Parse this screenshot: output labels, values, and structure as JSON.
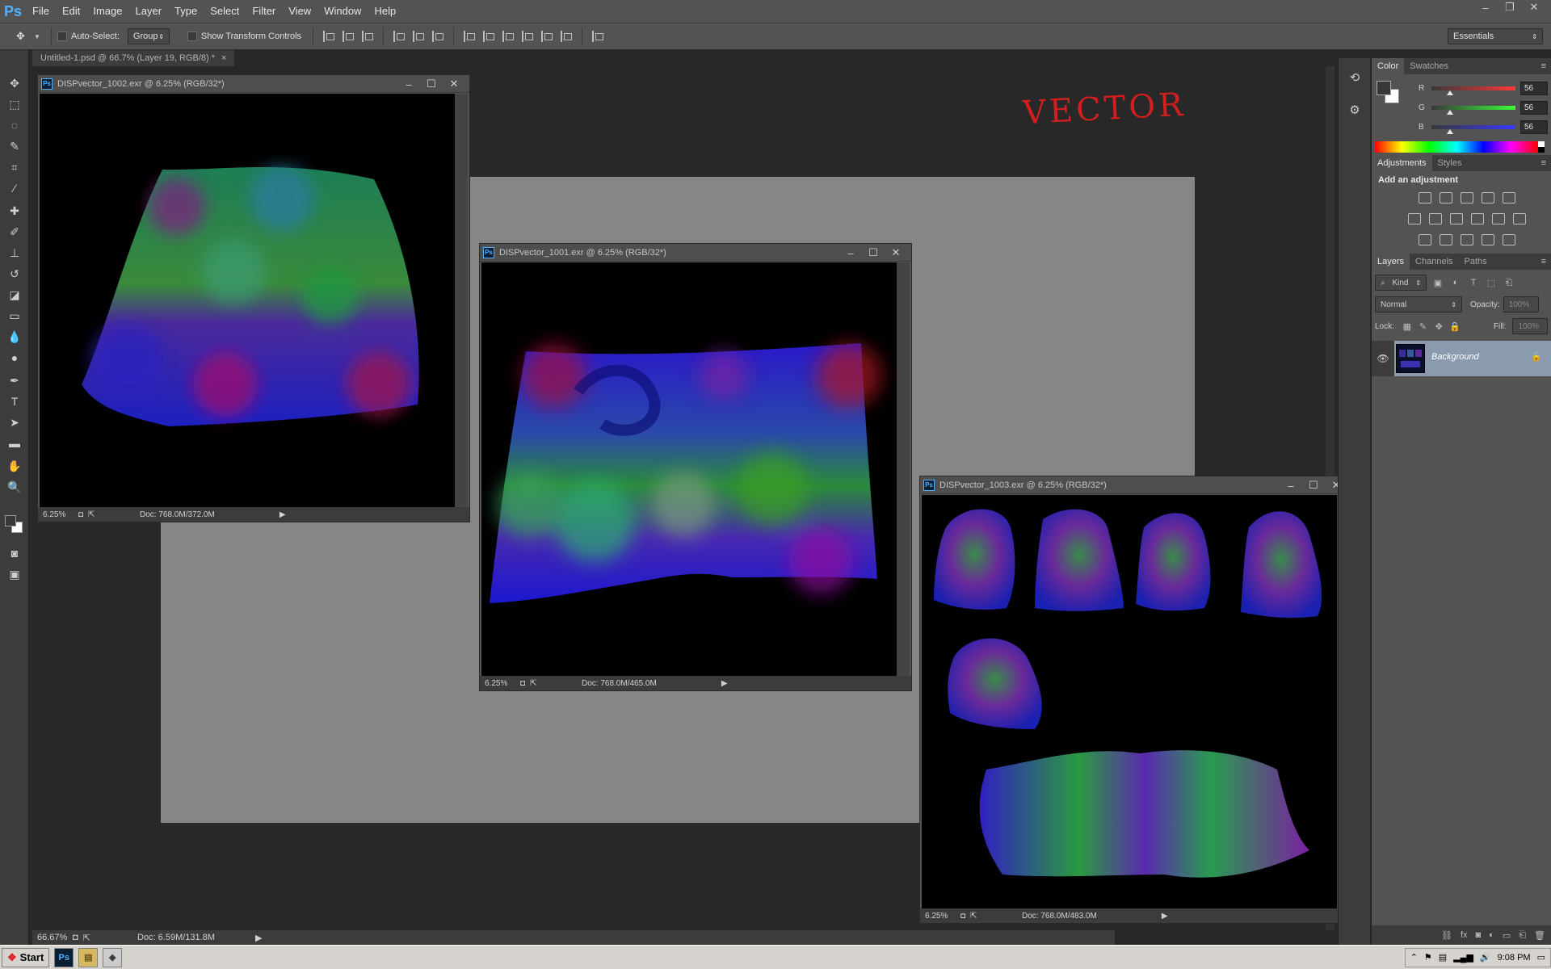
{
  "app": {
    "logo": "Ps"
  },
  "menu": [
    "File",
    "Edit",
    "Image",
    "Layer",
    "Type",
    "Select",
    "Filter",
    "View",
    "Window",
    "Help"
  ],
  "window_controls": {
    "minimize": "‒",
    "restore": "❐",
    "close": "✕"
  },
  "options_bar": {
    "auto_select_label": "Auto-Select:",
    "auto_select_value": "Group",
    "transform_label": "Show Transform Controls",
    "workspace": "Essentials"
  },
  "document_tab": {
    "title": "Untitled-1.psd @ 66.7% (Layer 19, RGB/8) *",
    "close": "×"
  },
  "canvas": {
    "annotation": "VECTOR",
    "annotation_color": "#d21e1e",
    "background": "#868686"
  },
  "windows": [
    {
      "title": "DISPvector_1002.exr @ 6.25% (RGB/32*)",
      "zoom": "6.25%",
      "doc": "Doc: 768.0M/372.0M"
    },
    {
      "title": "DISPvector_1001.exr @ 6.25% (RGB/32*)",
      "zoom": "6.25%",
      "doc": "Doc: 768.0M/465.0M"
    },
    {
      "title": "DISPvector_1003.exr @ 6.25% (RGB/32*)",
      "zoom": "6.25%",
      "doc": "Doc: 768.0M/483.0M"
    }
  ],
  "main_status": {
    "zoom": "66.67%",
    "doc": "Doc: 6.59M/131.8M"
  },
  "color_panel": {
    "tabs": [
      "Color",
      "Swatches"
    ],
    "r_label": "R",
    "g_label": "G",
    "b_label": "B",
    "r": "56",
    "g": "56",
    "b": "56",
    "r_fraction": 0.22,
    "g_fraction": 0.22,
    "b_fraction": 0.22,
    "fg_color": "#383838",
    "bg_color": "#ffffff"
  },
  "adjustments_panel": {
    "tabs": [
      "Adjustments",
      "Styles"
    ],
    "heading": "Add an adjustment"
  },
  "layers_panel": {
    "tabs": [
      "Layers",
      "Channels",
      "Paths"
    ],
    "filter": "Kind",
    "blend_mode": "Normal",
    "opacity_label": "Opacity:",
    "opacity": "100%",
    "lock_label": "Lock:",
    "fill_label": "Fill:",
    "fill": "100%",
    "layer_name": "Background"
  },
  "taskbar": {
    "start": "Start",
    "time": "9:08 PM"
  }
}
